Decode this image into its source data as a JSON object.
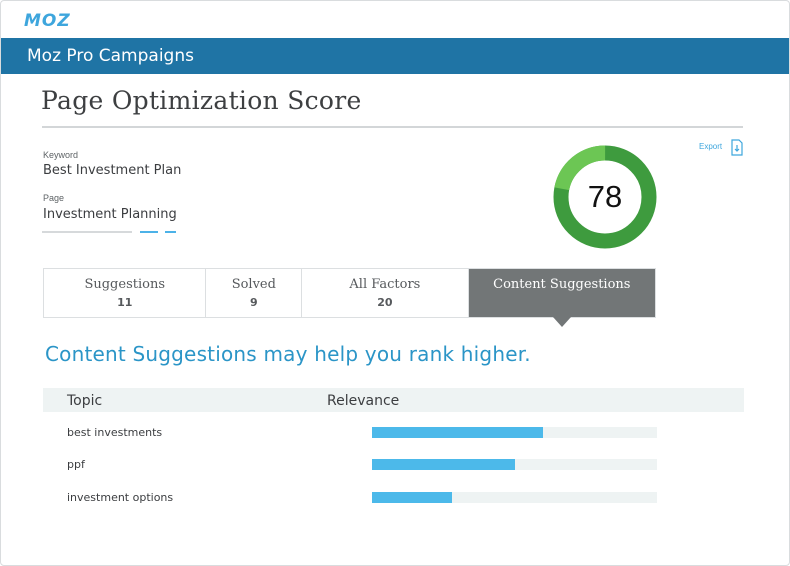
{
  "brand": {
    "logo_text": "MOZ",
    "accent": "#3ea6dd"
  },
  "header": {
    "title": "Moz Pro Campaigns",
    "bar_color": "#1f74a5"
  },
  "page": {
    "title": "Page Optimization Score"
  },
  "fields": {
    "keyword_label": "Keyword",
    "keyword_value": "Best Investment Plan",
    "page_label": "Page",
    "page_value": "Investment Planning"
  },
  "export": {
    "label": "Export",
    "icon": "export-download-icon"
  },
  "score": {
    "value": "78",
    "fraction": 0.78,
    "color_main": "#3e9b3e",
    "color_highlight": "#6cc654"
  },
  "tabs": [
    {
      "label": "Suggestions",
      "count": "11"
    },
    {
      "label": "Solved",
      "count": "9"
    },
    {
      "label": "All Factors",
      "count": "20"
    },
    {
      "label": "Content Suggestions",
      "active": true
    }
  ],
  "content": {
    "headline": "Content Suggestions may help you rank higher.",
    "columns": {
      "topic": "Topic",
      "relevance": "Relevance"
    },
    "rows": [
      {
        "topic": "best investments",
        "relevance": 0.6
      },
      {
        "topic": "ppf",
        "relevance": 0.5
      },
      {
        "topic": "investment options",
        "relevance": 0.28
      }
    ]
  }
}
